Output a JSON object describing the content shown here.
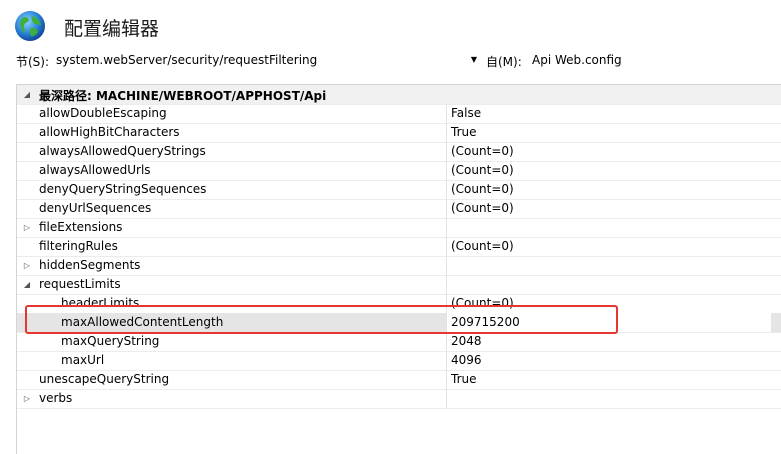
{
  "window": {
    "title": "配置编辑器"
  },
  "toolbar": {
    "section_label": "节(S):",
    "section_value": "system.webServer/security/requestFiltering",
    "from_label": "自(M):",
    "from_value": "Api Web.config"
  },
  "grid": {
    "group_label": "最深路径: MACHINE/WEBROOT/APPHOST/Api",
    "rows": [
      {
        "name": "allowDoubleEscaping",
        "value": "False"
      },
      {
        "name": "allowHighBitCharacters",
        "value": "True"
      },
      {
        "name": "alwaysAllowedQueryStrings",
        "value": "(Count=0)"
      },
      {
        "name": "alwaysAllowedUrls",
        "value": "(Count=0)"
      },
      {
        "name": "denyQueryStringSequences",
        "value": "(Count=0)"
      },
      {
        "name": "denyUrlSequences",
        "value": "(Count=0)"
      },
      {
        "name": "fileExtensions",
        "value": ""
      },
      {
        "name": "filteringRules",
        "value": "(Count=0)"
      },
      {
        "name": "hiddenSegments",
        "value": ""
      },
      {
        "name": "requestLimits",
        "value": ""
      },
      {
        "name": "headerLimits",
        "value": "(Count=0)"
      },
      {
        "name": "maxAllowedContentLength",
        "value": "209715200"
      },
      {
        "name": "maxQueryString",
        "value": "2048"
      },
      {
        "name": "maxUrl",
        "value": "4096"
      },
      {
        "name": "unescapeQueryString",
        "value": "True"
      },
      {
        "name": "verbs",
        "value": ""
      }
    ]
  },
  "icons": {
    "window": "globe-icon",
    "expand": "triangle-right-icon",
    "collapse": "triangle-down-icon",
    "dropdown": "dropdown-arrow-icon"
  },
  "colors": {
    "highlight": "#e5372f",
    "group_bg": "#f0f0f0"
  }
}
